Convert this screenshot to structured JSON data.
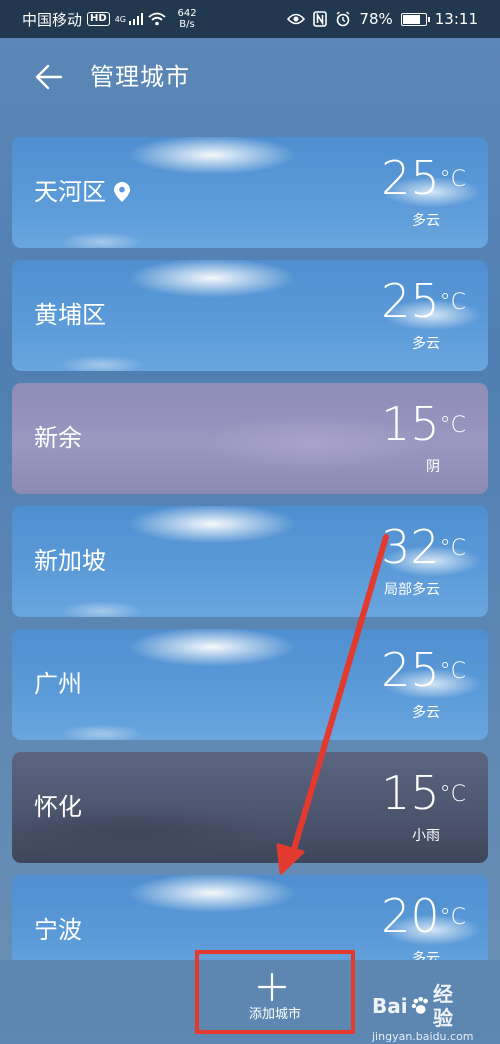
{
  "status_bar": {
    "carrier": "中国移动",
    "hd": "HD",
    "network": "4G",
    "speed_value": "642",
    "speed_unit": "B/s",
    "battery": "78%",
    "time": "13:11"
  },
  "app_bar": {
    "title": "管理城市"
  },
  "cities": [
    {
      "name": "天河区",
      "temp": "25",
      "unit": "°C",
      "condition": "多云",
      "current_location": true
    },
    {
      "name": "黄埔区",
      "temp": "25",
      "unit": "°C",
      "condition": "多云"
    },
    {
      "name": "新余",
      "temp": "15",
      "unit": "°C",
      "condition": "阴"
    },
    {
      "name": "新加坡",
      "temp": "32",
      "unit": "°C",
      "condition": "局部多云"
    },
    {
      "name": "广州",
      "temp": "25",
      "unit": "°C",
      "condition": "多云"
    },
    {
      "name": "怀化",
      "temp": "15",
      "unit": "°C",
      "condition": "小雨"
    },
    {
      "name": "宁波",
      "temp": "20",
      "unit": "°C",
      "condition": "多云"
    }
  ],
  "bottom": {
    "add_label": "添加城市"
  },
  "watermark": {
    "logo_a": "Bai",
    "logo_b": "经验",
    "sub": "jingyan.baidu.com"
  },
  "colors": {
    "annotation_red": "#e23a2f",
    "status_bar_bg": "#22384f"
  }
}
